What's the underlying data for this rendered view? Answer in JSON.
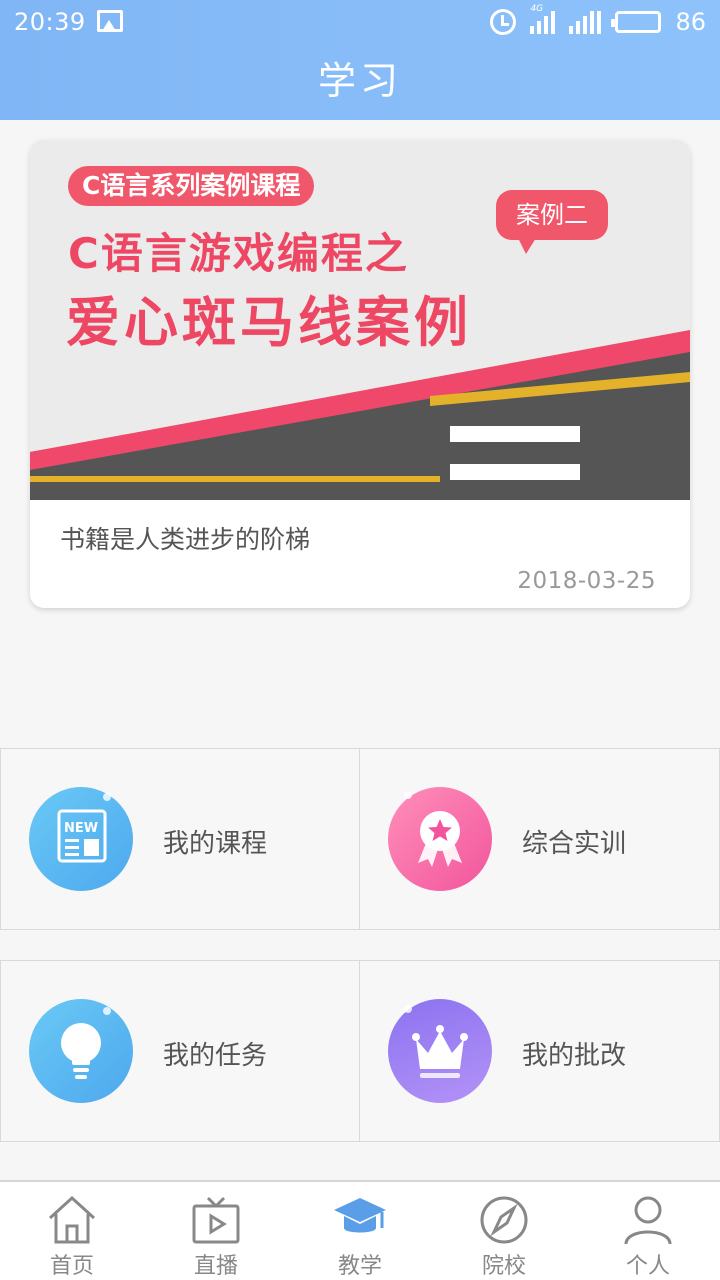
{
  "status_bar": {
    "time": "20:39",
    "battery": "86",
    "network": "4G"
  },
  "header": {
    "title": "学习"
  },
  "banner": {
    "series_tag": "C语言系列案例课程",
    "case_tag": "案例二",
    "line1": "C语言游戏编程之",
    "line2": "爱心斑马线案例",
    "caption": "书籍是人类进步的阶梯",
    "date": "2018-03-25"
  },
  "features": [
    {
      "label": "我的课程",
      "icon": "news-icon"
    },
    {
      "label": "综合实训",
      "icon": "medal-icon"
    },
    {
      "label": "我的任务",
      "icon": "lightbulb-icon"
    },
    {
      "label": "我的批改",
      "icon": "crown-icon"
    }
  ],
  "tabs": [
    {
      "label": "首页",
      "icon": "home-icon"
    },
    {
      "label": "直播",
      "icon": "tv-icon"
    },
    {
      "label": "教学",
      "icon": "graduation-cap-icon",
      "active": true
    },
    {
      "label": "院校",
      "icon": "compass-icon"
    },
    {
      "label": "个人",
      "icon": "person-icon"
    }
  ],
  "colors": {
    "header": "#8ec2fb",
    "accent_red": "#f1576a",
    "active_tab": "#5a9ee8"
  }
}
